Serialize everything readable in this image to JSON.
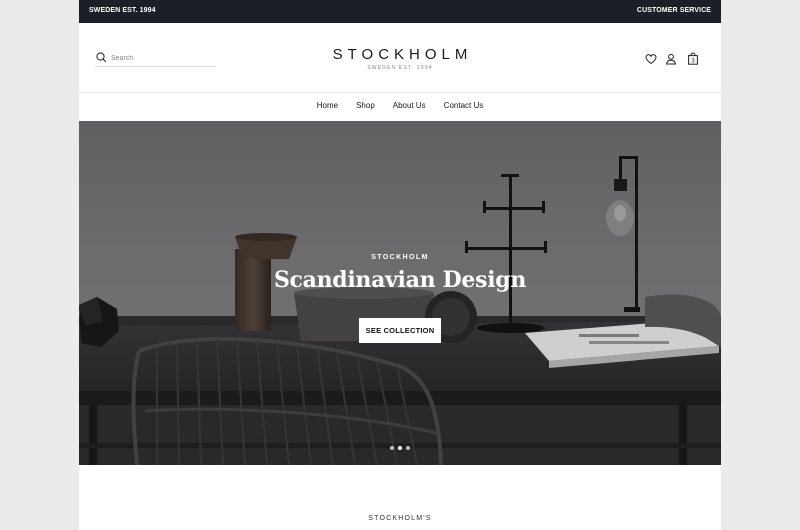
{
  "topbar": {
    "left_text": "SWEDEN EST. 1994",
    "right_link": "CUSTOMER SERVICE"
  },
  "search": {
    "placeholder": "Search"
  },
  "logo": {
    "name": "STOCKHOLM",
    "tagline": "SWEDEN EST. 1994"
  },
  "header_icons": {
    "cart_count": "3"
  },
  "nav": {
    "items": [
      "Home",
      "Shop",
      "About Us",
      "Contact Us"
    ]
  },
  "hero": {
    "eyebrow": "STOCKHOLM",
    "title": "Scandinavian Design",
    "button_label": "SEE COLLECTION",
    "slide_count": 3,
    "active_slide": 2
  },
  "next_section": {
    "eyebrow": "STOCKHOLM'S"
  },
  "colors": {
    "topbar_bg": "#1c1f26",
    "hero_bg": "#7a7a7c",
    "accent": "#ffffff"
  }
}
